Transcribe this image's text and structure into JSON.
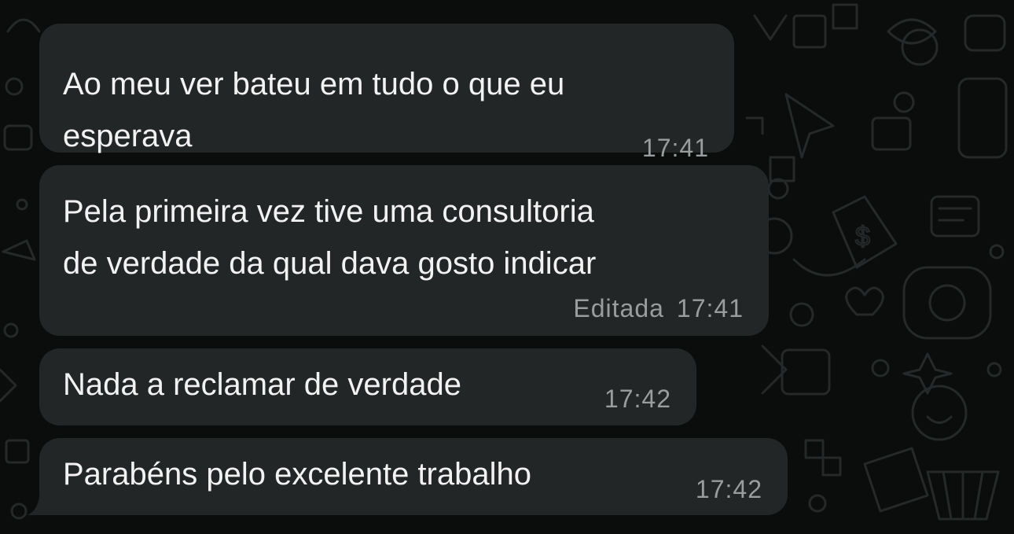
{
  "messages": [
    {
      "lines": [
        "Ao meu ver bateu em tudo o que eu",
        "esperava"
      ],
      "time": "17:41",
      "edited": ""
    },
    {
      "lines": [
        "Pela primeira vez tive uma consultoria",
        "de verdade da qual dava gosto indicar"
      ],
      "time": "17:41",
      "edited": "Editada"
    },
    {
      "lines": [
        "Nada a reclamar de verdade"
      ],
      "time": "17:42",
      "edited": ""
    },
    {
      "lines": [
        "Parabéns pelo excelente trabalho"
      ],
      "time": "17:42",
      "edited": ""
    }
  ],
  "colors": {
    "background": "#0b0c0c",
    "bubble": "#232626",
    "text": "#f2f2f2",
    "meta": "#9a9d9d",
    "doodle": "#2a2d2d"
  }
}
